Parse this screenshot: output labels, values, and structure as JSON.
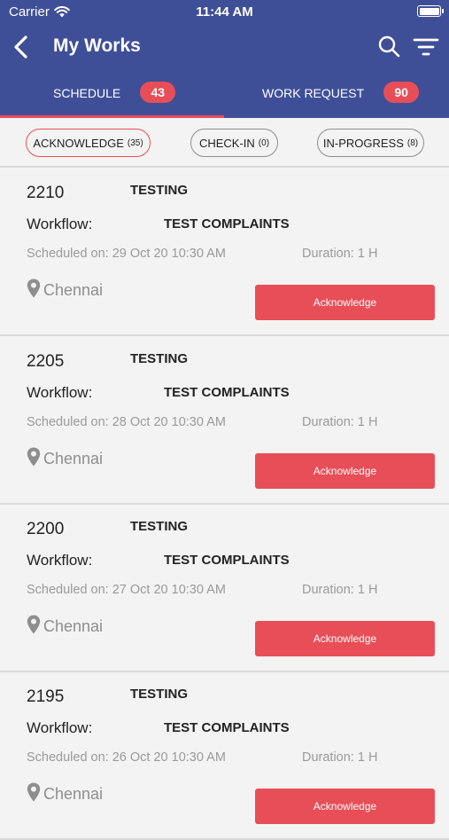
{
  "status_bar": {
    "carrier": "Carrier",
    "time": "11:44 AM"
  },
  "nav": {
    "title": "My Works",
    "back_icon": "chevron-left-icon",
    "search_icon": "search-icon",
    "filter_icon": "filter-icon"
  },
  "tabs": [
    {
      "label": "SCHEDULE",
      "count": "43",
      "selected": true
    },
    {
      "label": "WORK REQUEST",
      "count": "90",
      "selected": false
    }
  ],
  "filters": [
    {
      "label": "ACKNOWLEDGE",
      "count": "(35)",
      "selected": true
    },
    {
      "label": "CHECK-IN",
      "count": "(0)",
      "selected": false
    },
    {
      "label": "IN-PROGRESS",
      "count": "(8)",
      "selected": false
    }
  ],
  "cards": [
    {
      "id": "2210",
      "name": "TESTING",
      "workflow_label": "Workflow:",
      "workflow": "TEST COMPLAINTS",
      "scheduled": "Scheduled on: 29 Oct 20 10:30 AM",
      "duration": "Duration: 1 H",
      "location": "Chennai",
      "action": "Acknowledge"
    },
    {
      "id": "2205",
      "name": "TESTING",
      "workflow_label": "Workflow:",
      "workflow": "TEST COMPLAINTS",
      "scheduled": "Scheduled on: 28 Oct 20 10:30 AM",
      "duration": "Duration: 1 H",
      "location": "Chennai",
      "action": "Acknowledge"
    },
    {
      "id": "2200",
      "name": "TESTING",
      "workflow_label": "Workflow:",
      "workflow": "TEST COMPLAINTS",
      "scheduled": "Scheduled on: 27 Oct 20 10:30 AM",
      "duration": "Duration: 1 H",
      "location": "Chennai",
      "action": "Acknowledge"
    },
    {
      "id": "2195",
      "name": "TESTING",
      "workflow_label": "Workflow:",
      "workflow": "TEST COMPLAINTS",
      "scheduled": "Scheduled on: 26 Oct 20 10:30 AM",
      "duration": "Duration: 1 H",
      "location": "Chennai",
      "action": "Acknowledge"
    }
  ],
  "colors": {
    "header": "#3f4f97",
    "accent": "#e84e57",
    "background": "#f3f3f3"
  }
}
